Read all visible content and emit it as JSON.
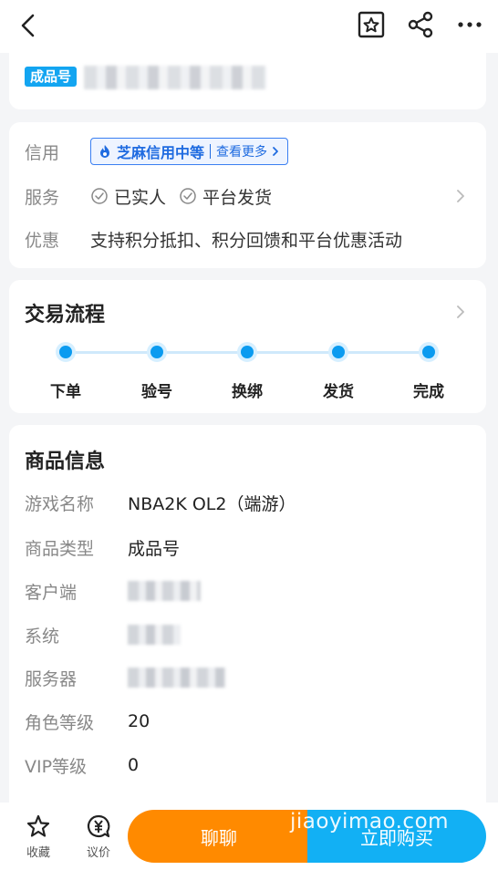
{
  "header": {
    "back_icon": "chevron-left-icon",
    "favorite_icon": "star-badge-icon",
    "share_icon": "share-icon",
    "more_icon": "more-dots-icon"
  },
  "account": {
    "tag": "成品号"
  },
  "info": {
    "credit": {
      "label": "信用",
      "badge_text": "芝麻信用中等",
      "more_text": "查看更多"
    },
    "service": {
      "label": "服务",
      "items": [
        "已实人",
        "平台发货"
      ]
    },
    "promo": {
      "label": "优惠",
      "text": "支持积分抵扣、积分回馈和平台优惠活动"
    }
  },
  "flow": {
    "title": "交易流程",
    "steps": [
      "下单",
      "验号",
      "换绑",
      "发货",
      "完成"
    ]
  },
  "goods": {
    "title": "商品信息",
    "rows": [
      {
        "label": "游戏名称",
        "value": "NBA2K OL2（端游）"
      },
      {
        "label": "商品类型",
        "value": "成品号"
      },
      {
        "label": "客户端",
        "value": ""
      },
      {
        "label": "系统",
        "value": ""
      },
      {
        "label": "服务器",
        "value": ""
      },
      {
        "label": "角色等级",
        "value": "20"
      },
      {
        "label": "VIP等级",
        "value": "0"
      }
    ]
  },
  "bottom": {
    "collect_label": "收藏",
    "bargain_label": "议价",
    "chat_label": "聊聊",
    "buy_label": "立即购买",
    "watermark": "jiaoyimao.com"
  },
  "colors": {
    "accent": "#12b0f4",
    "orange": "#ff8a00",
    "credit_blue": "#1f6be0"
  }
}
